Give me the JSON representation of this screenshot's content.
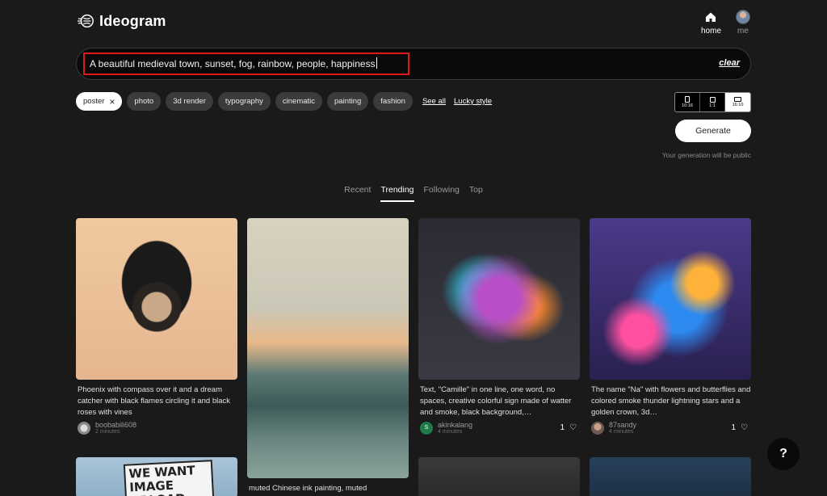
{
  "app": {
    "name": "Ideogram"
  },
  "nav": {
    "home": "home",
    "me": "me"
  },
  "prompt": {
    "text": "A beautiful medieval town, sunset, fog, rainbow, people, happiness",
    "clear": "clear"
  },
  "chips": [
    {
      "label": "poster",
      "active": true
    },
    {
      "label": "photo"
    },
    {
      "label": "3d render"
    },
    {
      "label": "typography"
    },
    {
      "label": "cinematic"
    },
    {
      "label": "painting"
    },
    {
      "label": "fashion"
    }
  ],
  "links": {
    "see_all": "See all",
    "lucky": "Lucky style"
  },
  "aspect": [
    {
      "label": "10:16"
    },
    {
      "label": "1:1"
    },
    {
      "label": "16:10",
      "active": true
    }
  ],
  "generate": {
    "label": "Generate",
    "note": "Your generation will be public"
  },
  "tabs": [
    {
      "label": "Recent"
    },
    {
      "label": "Trending",
      "active": true
    },
    {
      "label": "Following"
    },
    {
      "label": "Top"
    }
  ],
  "cards": [
    {
      "caption": "Phoenix with compass over it and a dream catcher with black flames circling it and black roses with vines",
      "user": "boobabili608",
      "time": "2 minutes",
      "likes": ""
    },
    {
      "caption": "muted Chinese ink painting, muted",
      "user": "",
      "time": "",
      "likes": ""
    },
    {
      "caption": "Text, \"Camille\" in one line, one word, no spaces, creative colorful sign made of watter and smoke, black background,…",
      "user": "akinkalang",
      "time": "4 minutes",
      "likes": "1",
      "avatar_letter": "S"
    },
    {
      "caption": "The name \"Na\" with flowers and butterflies and colored smoke thunder lightning stars and a golden crown, 3d…",
      "user": "87sandy",
      "time": "4 minutes",
      "likes": "1"
    }
  ],
  "partial_text": {
    "poster_sign": "WE WANT IMAGE UPLOAD"
  },
  "help": {
    "label": "?"
  },
  "colors": {
    "accent_highlight": "#e01a1a",
    "background": "#1a1a1a",
    "chip": "#3b3b3b"
  }
}
